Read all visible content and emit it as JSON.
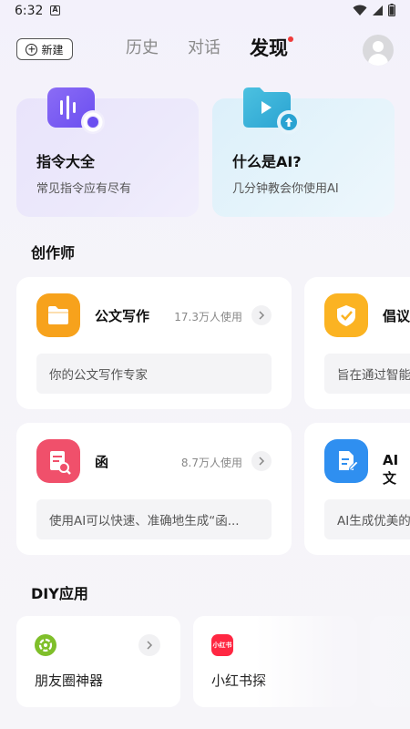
{
  "status_bar": {
    "time": "6:32",
    "notification_letter": "A"
  },
  "header": {
    "new_label": "新建",
    "tabs": [
      {
        "label": "历史"
      },
      {
        "label": "对话"
      },
      {
        "label": "发现",
        "active": true
      }
    ]
  },
  "featured": [
    {
      "title": "指令大全",
      "subtitle": "常见指令应有尽有"
    },
    {
      "title": "什么是AI?",
      "subtitle": "几分钟教会你使用AI"
    }
  ],
  "sections": {
    "creators": "创作师",
    "diy": "DIY应用"
  },
  "creators": [
    {
      "name": "公文写作",
      "usage": "17.3万人使用",
      "desc": "你的公文写作专家",
      "icon": "folder-icon",
      "color": "#f7a21c"
    },
    {
      "name": "倡议",
      "usage": "",
      "desc": "旨在通过智能",
      "icon": "shield-check-icon",
      "color": "#fbb322"
    },
    {
      "name": "函",
      "usage": "8.7万人使用",
      "desc": "使用AI可以快速、准确地生成“函...",
      "icon": "letter-search-icon",
      "color": "#f0506b"
    },
    {
      "name": "AI文",
      "usage": "",
      "desc": "AI生成优美的",
      "icon": "document-edit-icon",
      "color": "#2f8ff0"
    }
  ],
  "diy_apps": [
    {
      "label": "朋友圈神器",
      "icon": "moments-icon",
      "color": "#7fbf2a"
    },
    {
      "label": "小红书探",
      "icon": "xiaohongshu-icon",
      "color": "#ff2742",
      "icon_text": "小红书"
    }
  ]
}
